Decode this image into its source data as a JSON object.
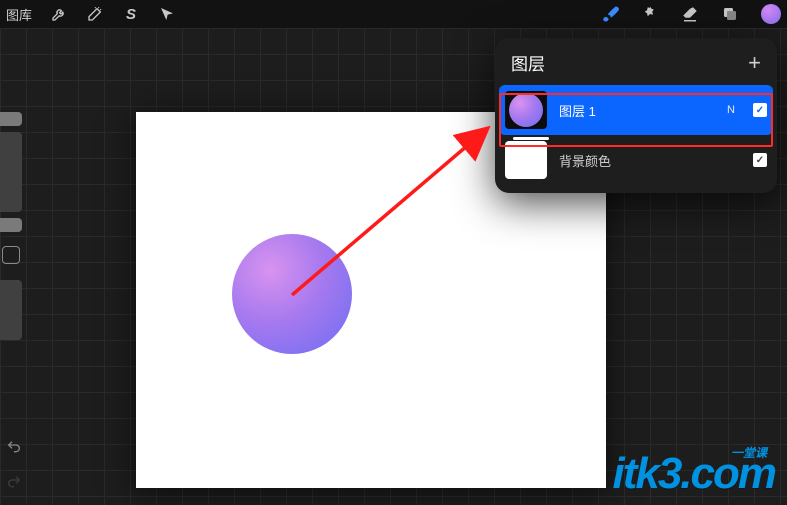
{
  "topbar": {
    "library_label": "图库",
    "icons": {
      "wrench": "wrench-icon",
      "wand": "wand-icon",
      "s": "selection-icon",
      "arrow": "move-icon",
      "brush": "brush-icon",
      "smudge": "smudge-icon",
      "eraser": "eraser-icon",
      "layers": "layers-icon",
      "color": "color-picker"
    }
  },
  "layers_panel": {
    "title": "图层",
    "add_label": "+",
    "rows": [
      {
        "name": "图层 1",
        "blend": "N",
        "visible": true,
        "selected": true,
        "thumb": "circle"
      },
      {
        "name": "背景颜色",
        "blend": "",
        "visible": true,
        "selected": false,
        "thumb": "white"
      }
    ]
  },
  "watermark": {
    "text": "itk3",
    "suffix": ".com",
    "tagline": "一堂课"
  },
  "annotation": {
    "highlight_layer_index": 0
  }
}
